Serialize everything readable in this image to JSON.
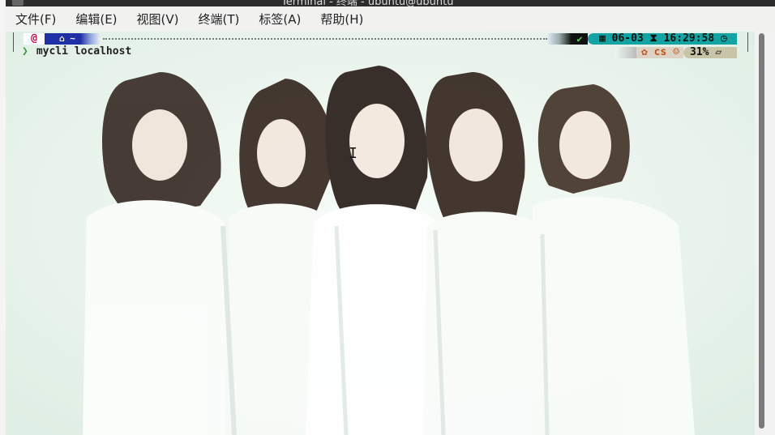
{
  "window": {
    "title": "Terminal - 终端 - ubuntu@ubuntu"
  },
  "menubar": {
    "items": [
      {
        "label": "文件(F)"
      },
      {
        "label": "编辑(E)"
      },
      {
        "label": "视图(V)"
      },
      {
        "label": "终端(T)"
      },
      {
        "label": "标签(A)"
      },
      {
        "label": "帮助(H)"
      }
    ]
  },
  "prompt": {
    "os_icon": "debian-swirl-icon",
    "home_label": "~",
    "status_icon": "checkmark-icon",
    "date": "06-03",
    "time": "16:29:58",
    "context": "cs",
    "battery": "31%"
  },
  "command": {
    "text": "mycli localhost"
  },
  "colors": {
    "terminal_bg": "#eaf6ee",
    "home_segment": "#1f2fa6",
    "time_segment": "#13a3a3",
    "prompt_chevron": "#3c9a3c"
  }
}
